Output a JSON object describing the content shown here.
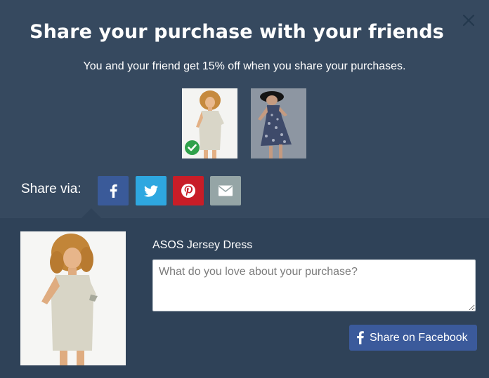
{
  "modal": {
    "title": "Share your purchase with your friends",
    "subtitle": "You and your friend get 15% off when you share your purchases.",
    "close_icon": "close-icon"
  },
  "thumbnails": [
    {
      "name": "thumbnail-beige-dress",
      "selected": true
    },
    {
      "name": "thumbnail-floral-dress",
      "selected": false
    }
  ],
  "share": {
    "label": "Share via:",
    "buttons": [
      {
        "icon": "facebook-icon",
        "color": "#3a5a99"
      },
      {
        "icon": "twitter-icon",
        "color": "#2ea7e0"
      },
      {
        "icon": "pinterest-icon",
        "color": "#c81d27"
      },
      {
        "icon": "mail-icon",
        "color": "#95a5a6"
      }
    ]
  },
  "product": {
    "name": "ASOS Jersey Dress",
    "comment_placeholder": "What do you love about your purchase?",
    "comment_value": "",
    "share_button_label": "Share on Facebook"
  },
  "colors": {
    "background_top": "#36495f",
    "background_bottom": "#2f4258",
    "facebook": "#3b5a9b",
    "check": "#2fa14b"
  }
}
